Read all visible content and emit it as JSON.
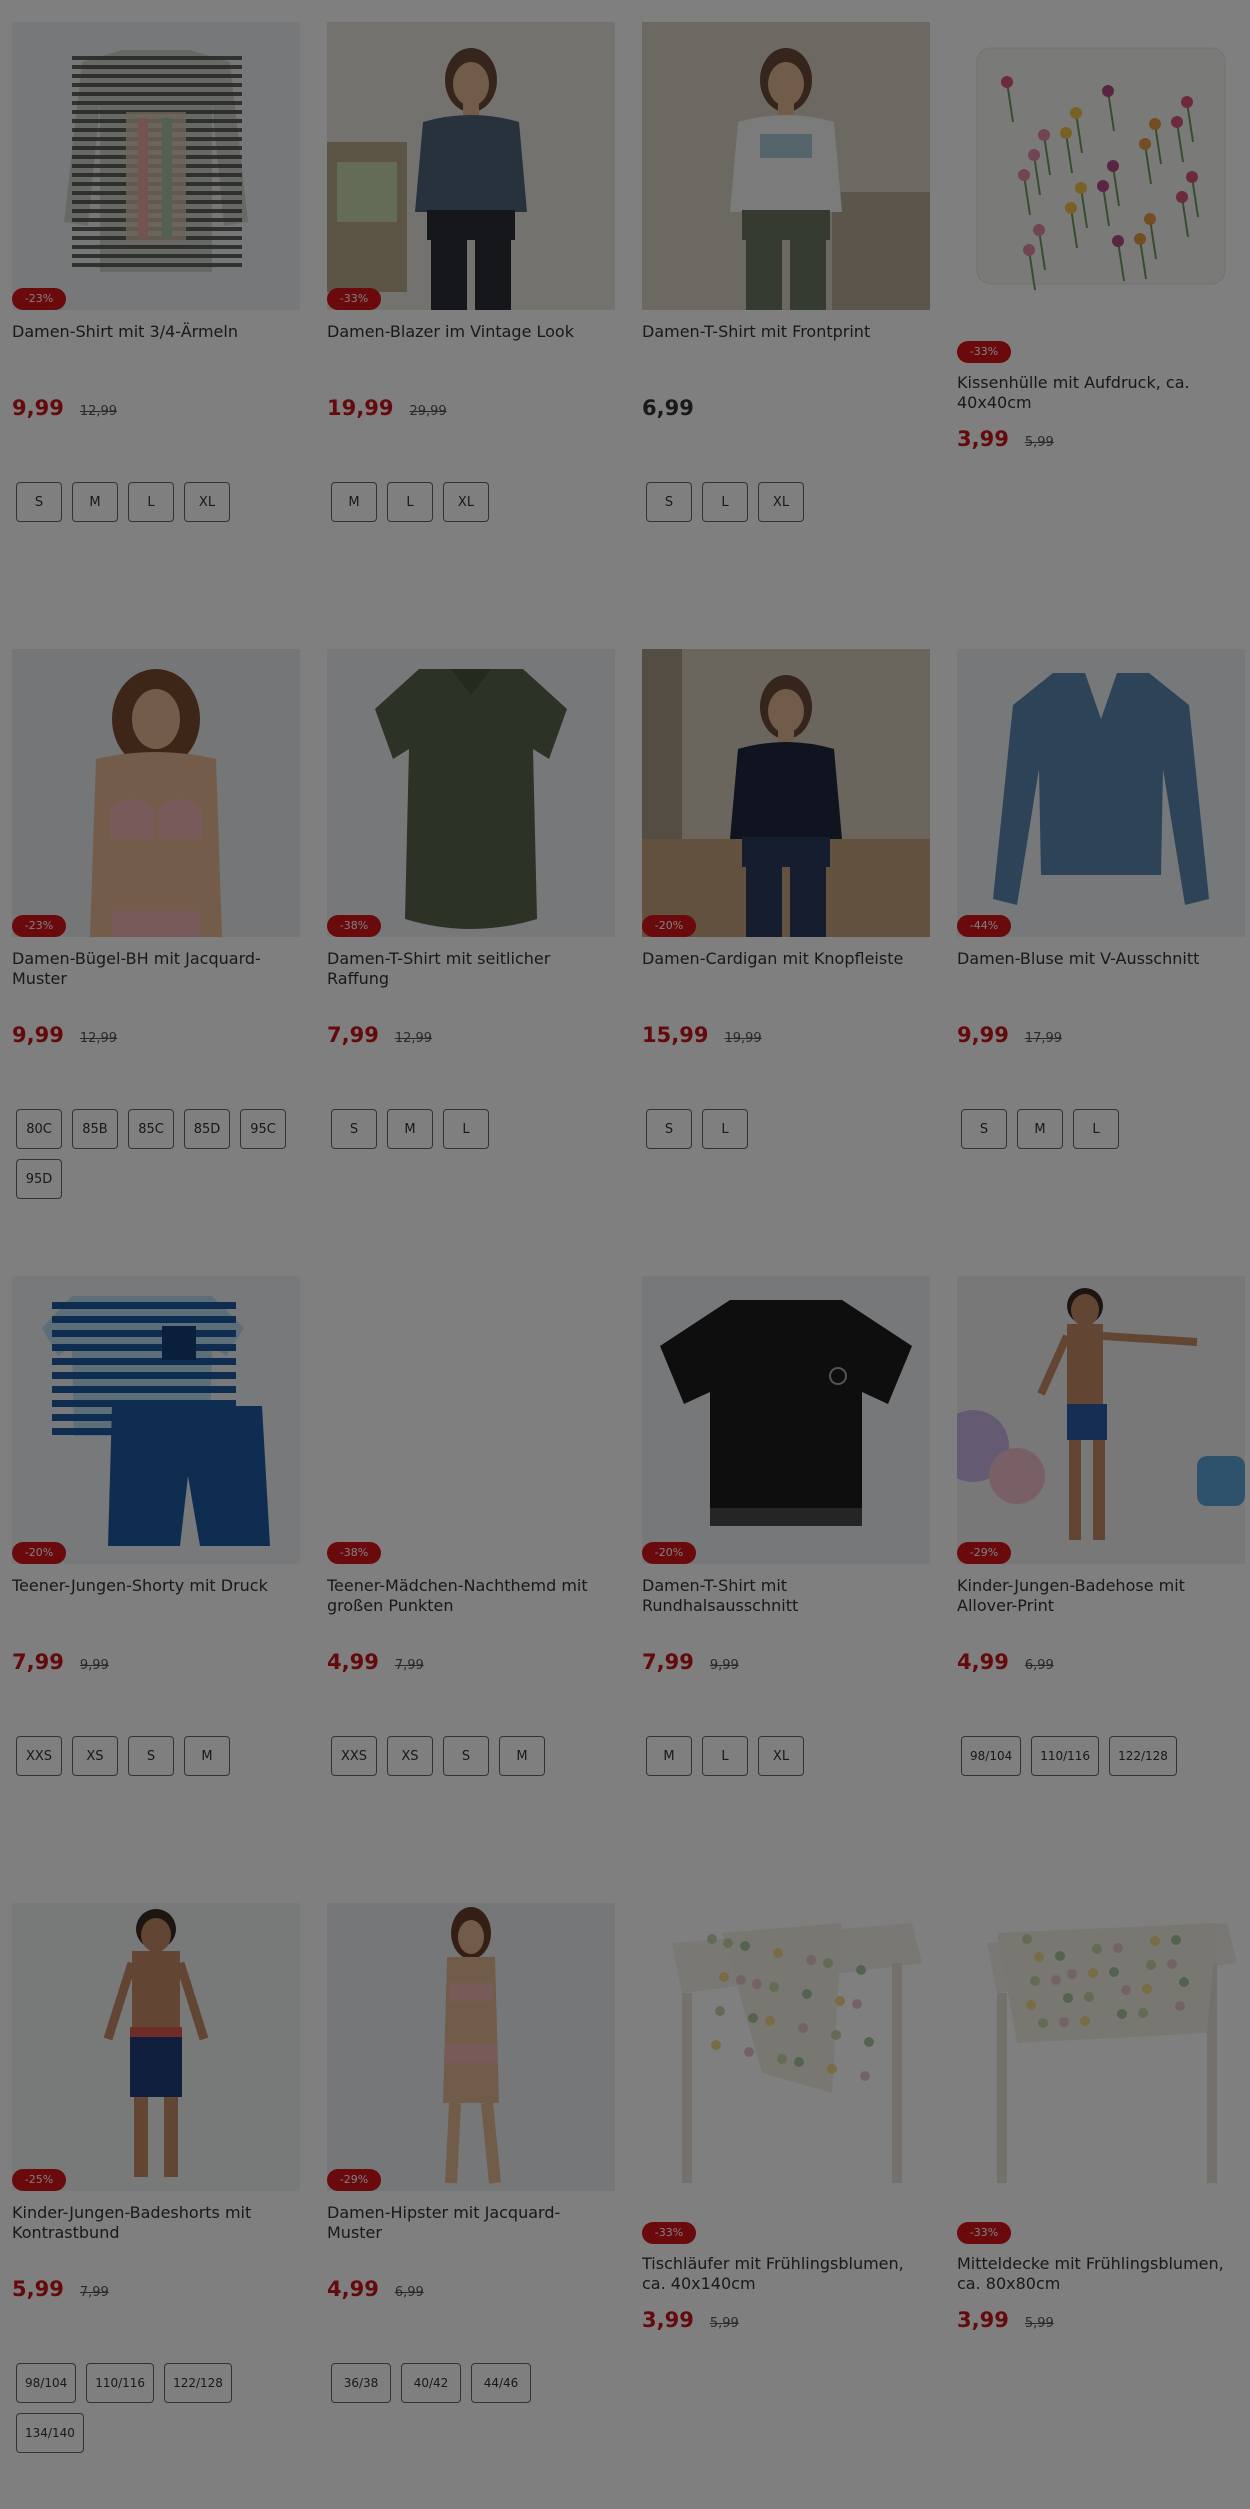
{
  "products": [
    {
      "title": "Damen-Shirt mit 3/4-Ärmeln",
      "badge": "-23%",
      "price": "9,99",
      "old_price": "12,99",
      "sizes": [
        "S",
        "M",
        "L",
        "XL"
      ],
      "image": "striped-shirt",
      "badge_pos": "image"
    },
    {
      "title": "Damen-Blazer im Vintage Look",
      "badge": "-33%",
      "price": "19,99",
      "old_price": "29,99",
      "sizes": [
        "M",
        "L",
        "XL"
      ],
      "image": "denim-blazer",
      "badge_pos": "image"
    },
    {
      "title": "Damen-T-Shirt mit Frontprint",
      "badge": "",
      "price": "6,99",
      "old_price": "",
      "sizes": [
        "S",
        "L",
        "XL"
      ],
      "image": "white-tshirt",
      "badge_pos": "none"
    },
    {
      "title": "Kissenhülle mit Aufdruck, ca. 40x40cm",
      "badge": "-33%",
      "price": "3,99",
      "old_price": "5,99",
      "sizes": [],
      "image": "floral-pillow",
      "badge_pos": "body"
    },
    {
      "title": "Damen-Bügel-BH mit Jacquard-Muster",
      "badge": "-23%",
      "price": "9,99",
      "old_price": "12,99",
      "sizes": [
        "80C",
        "85B",
        "85C",
        "85D",
        "95C",
        "95D"
      ],
      "image": "pink-bra",
      "badge_pos": "image"
    },
    {
      "title": "Damen-T-Shirt mit seitlicher Raffung",
      "badge": "-38%",
      "price": "7,99",
      "old_price": "12,99",
      "sizes": [
        "S",
        "M",
        "L"
      ],
      "image": "olive-tshirt",
      "badge_pos": "image"
    },
    {
      "title": "Damen-Cardigan mit Knopfleiste",
      "badge": "-20%",
      "price": "15,99",
      "old_price": "19,99",
      "sizes": [
        "S",
        "L"
      ],
      "image": "navy-cardigan",
      "badge_pos": "image"
    },
    {
      "title": "Damen-Bluse mit V-Ausschnitt",
      "badge": "-44%",
      "price": "9,99",
      "old_price": "17,99",
      "sizes": [
        "S",
        "M",
        "L"
      ],
      "image": "blue-blouse",
      "badge_pos": "image"
    },
    {
      "title": "Teener-Jungen-Shorty mit Druck",
      "badge": "-20%",
      "price": "7,99",
      "old_price": "9,99",
      "sizes": [
        "XXS",
        "XS",
        "S",
        "M"
      ],
      "image": "boys-shorty",
      "badge_pos": "image"
    },
    {
      "title": "Teener-Mädchen-Nachthemd mit großen Punkten",
      "badge": "-38%",
      "price": "4,99",
      "old_price": "7,99",
      "sizes": [
        "XXS",
        "XS",
        "S",
        "M"
      ],
      "image": "blank",
      "badge_pos": "image"
    },
    {
      "title": "Damen-T-Shirt mit Rundhalsausschnitt",
      "badge": "-20%",
      "price": "7,99",
      "old_price": "9,99",
      "sizes": [
        "M",
        "L",
        "XL"
      ],
      "image": "black-tshirt",
      "badge_pos": "image"
    },
    {
      "title": "Kinder-Jungen-Badehose mit Allover-Print",
      "badge": "-29%",
      "price": "4,99",
      "old_price": "6,99",
      "sizes": [
        "98/104",
        "110/116",
        "122/128"
      ],
      "image": "kid-swimtrunks",
      "badge_pos": "image"
    },
    {
      "title": "Kinder-Jungen-Badeshorts mit Kontrastbund",
      "badge": "-25%",
      "price": "5,99",
      "old_price": "7,99",
      "sizes": [
        "98/104",
        "110/116",
        "122/128",
        "134/140"
      ],
      "image": "kid-boardshorts",
      "badge_pos": "image"
    },
    {
      "title": "Damen-Hipster mit Jacquard-Muster",
      "badge": "-29%",
      "price": "4,99",
      "old_price": "6,99",
      "sizes": [
        "36/38",
        "40/42",
        "44/46"
      ],
      "image": "hipster",
      "badge_pos": "image"
    },
    {
      "title": "Tischläufer mit Frühlingsblumen, ca. 40x140cm",
      "badge": "-33%",
      "price": "3,99",
      "old_price": "5,99",
      "sizes": [],
      "image": "table-runner",
      "badge_pos": "body"
    },
    {
      "title": "Mitteldecke mit Frühlingsblumen, ca. 80x80cm",
      "badge": "-33%",
      "price": "3,99",
      "old_price": "5,99",
      "sizes": [],
      "image": "table-cloth",
      "badge_pos": "body"
    }
  ],
  "colors": {
    "badge": "#d4141b",
    "price": "#c8141a",
    "overlay": "rgba(0,0,0,0.5)"
  }
}
